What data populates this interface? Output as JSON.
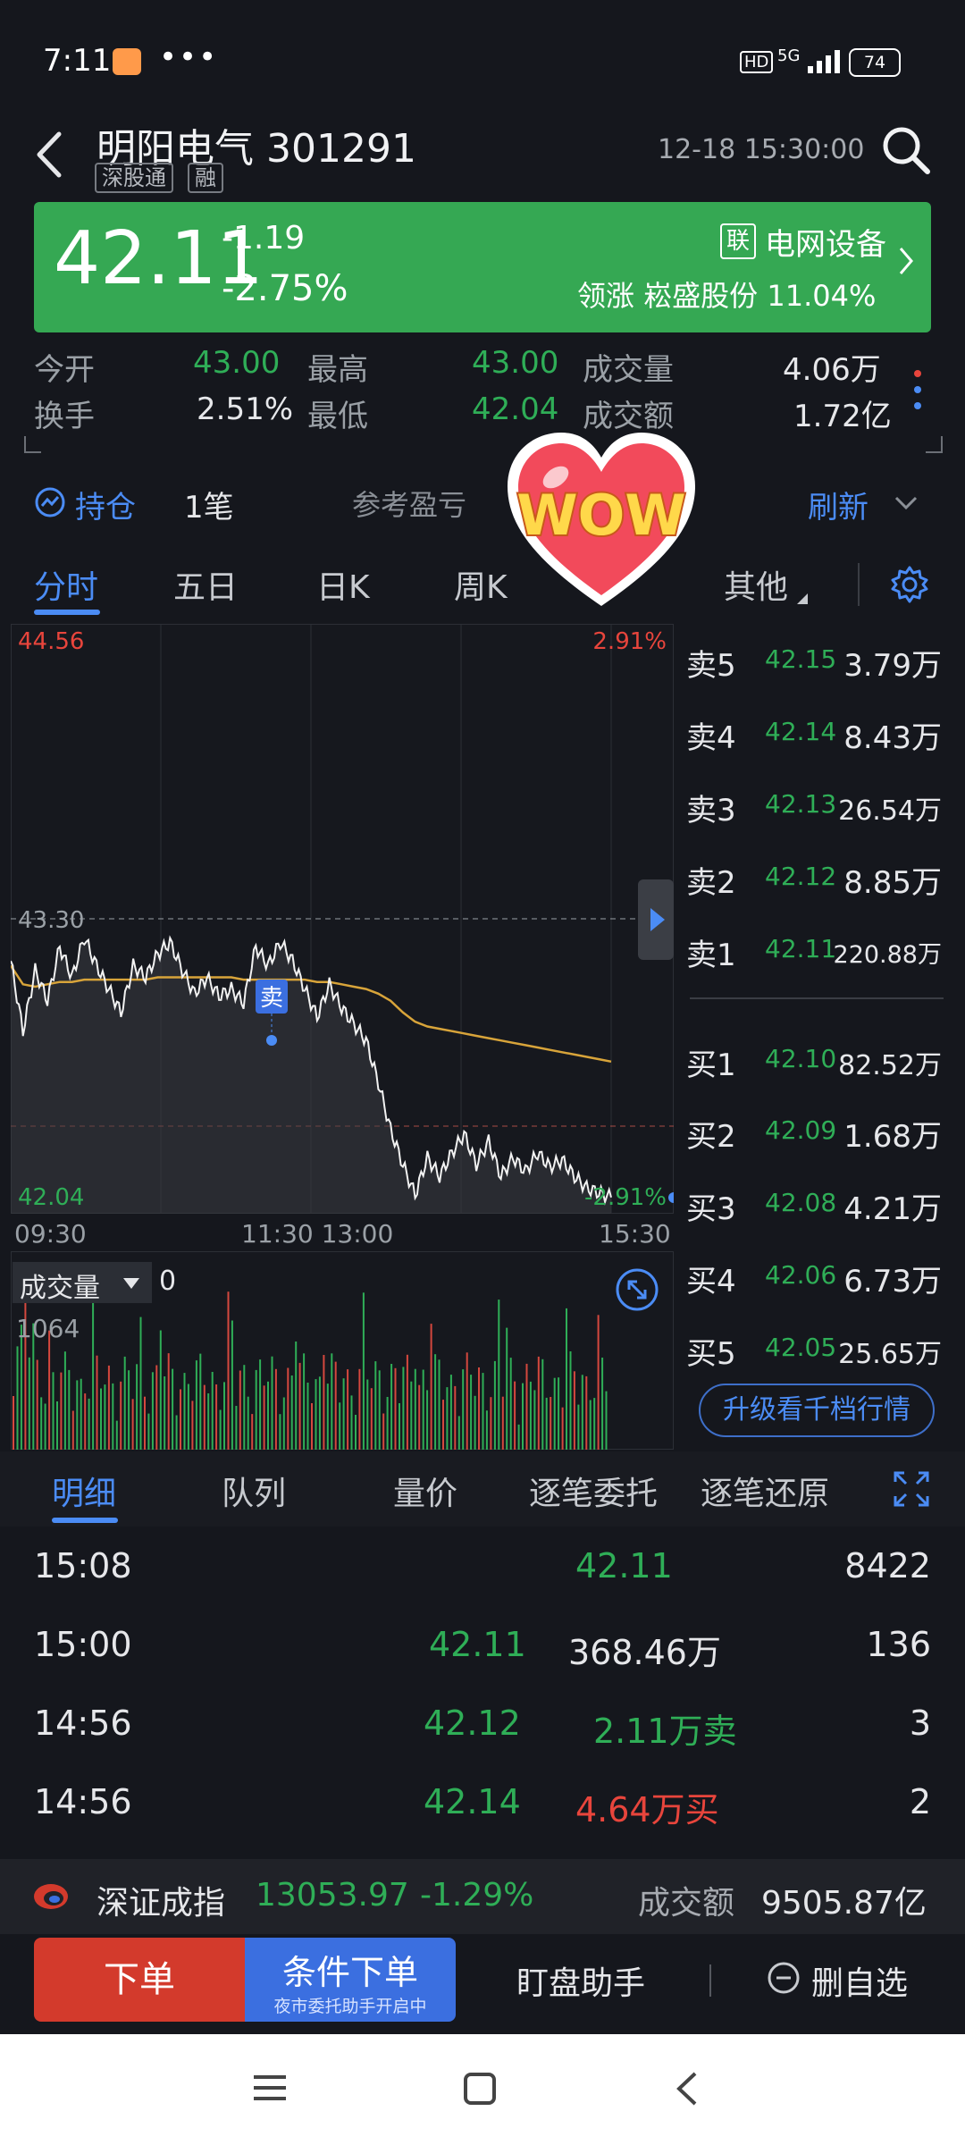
{
  "status": {
    "time": "7:11",
    "battery": "74",
    "hd": "HD",
    "network": "5G"
  },
  "header": {
    "name": "明阳电气 301291",
    "tags": [
      "深股通",
      "融"
    ],
    "datetime": "12-18 15:30:00"
  },
  "banner": {
    "price": "42.11",
    "change": "-1.19",
    "change_pct": "-2.75%",
    "sector_mark": "联",
    "sector": "电网设备",
    "leader": "领涨 崧盛股份 11.04%",
    "color": "#35a853"
  },
  "stats": {
    "open_label": "今开",
    "open": "43.00",
    "high_label": "最高",
    "high": "43.00",
    "volume_label": "成交量",
    "volume": "4.06万",
    "turnover_label": "换手",
    "turnover": "2.51%",
    "low_label": "最低",
    "low": "42.04",
    "amount_label": "成交额",
    "amount": "1.72亿"
  },
  "holdings": {
    "label": "持仓",
    "count": "1笔",
    "pnl_label": "参考盈亏",
    "refresh": "刷新"
  },
  "sticker": {
    "text": "WOW"
  },
  "chart_tabs": [
    "分时",
    "五日",
    "日K",
    "周K",
    "其他"
  ],
  "chart": {
    "y_top": "44.56",
    "y_mid": "43.30",
    "y_bottom": "42.04",
    "pct_top": "2.91%",
    "pct_bottom": "-2.91%",
    "times": [
      "09:30",
      "11:30 13:00",
      "15:30"
    ],
    "sell_marker": "卖"
  },
  "chart_data": {
    "type": "line",
    "title": "",
    "ylim": [
      42.04,
      44.56
    ],
    "prev_close": 43.3,
    "series": [
      {
        "name": "",
        "values": [
          43.12,
          42.82,
          43.08,
          42.95,
          43.18,
          43.05,
          43.22,
          43.1,
          43.0,
          42.9,
          43.1,
          43.05,
          43.15,
          43.2,
          43.08,
          42.98,
          43.05,
          42.97,
          43.0,
          42.94,
          43.18,
          43.1,
          43.2,
          43.12,
          43.0,
          42.88,
          43.02,
          42.92,
          42.85,
          42.78,
          42.6,
          42.4,
          42.25,
          42.12,
          42.28,
          42.2,
          42.3,
          42.38,
          42.25,
          42.35,
          42.2,
          42.28,
          42.22,
          42.3,
          42.24,
          42.27,
          42.2,
          42.15,
          42.13,
          42.11
        ]
      },
      {
        "name": "",
        "values": [
          43.1,
          43.02,
          43.01,
          43.02,
          43.03,
          43.03,
          43.04,
          43.04,
          43.04,
          43.04,
          43.04,
          43.04,
          43.05,
          43.05,
          43.05,
          43.05,
          43.05,
          43.05,
          43.05,
          43.04,
          43.04,
          43.04,
          43.04,
          43.04,
          43.04,
          43.03,
          43.03,
          43.02,
          43.01,
          43.0,
          42.98,
          42.95,
          42.9,
          42.86,
          42.84,
          42.83,
          42.82,
          42.81,
          42.8,
          42.79,
          42.78,
          42.77,
          42.76,
          42.75,
          42.74,
          42.73,
          42.72,
          42.71,
          42.7,
          42.69
        ]
      }
    ],
    "volume_max": "1064"
  },
  "volume": {
    "label": "成交量",
    "value": "0",
    "max": "1064"
  },
  "orderbook": {
    "sells": [
      {
        "label": "卖5",
        "price": "42.15",
        "vol": "3.79万"
      },
      {
        "label": "卖4",
        "price": "42.14",
        "vol": "8.43万"
      },
      {
        "label": "卖3",
        "price": "42.13",
        "vol": "26.54万"
      },
      {
        "label": "卖2",
        "price": "42.12",
        "vol": "8.85万"
      },
      {
        "label": "卖1",
        "price": "42.11",
        "vol": "220.88万"
      }
    ],
    "buys": [
      {
        "label": "买1",
        "price": "42.10",
        "vol": "82.52万"
      },
      {
        "label": "买2",
        "price": "42.09",
        "vol": "1.68万"
      },
      {
        "label": "买3",
        "price": "42.08",
        "vol": "4.21万"
      },
      {
        "label": "买4",
        "price": "42.06",
        "vol": "6.73万"
      },
      {
        "label": "买5",
        "price": "42.05",
        "vol": "25.65万"
      }
    ],
    "upgrade": "升级看千档行情"
  },
  "detail_tabs": [
    "明细",
    "队列",
    "量价",
    "逐笔委托",
    "逐笔还原"
  ],
  "trades": [
    {
      "time": "15:08",
      "price": "42.11",
      "amount": "",
      "count": "8422"
    },
    {
      "time": "15:00",
      "price": "42.11",
      "amount": "368.46万",
      "count": "136"
    },
    {
      "time": "14:56",
      "price": "42.12",
      "amount": "2.11万卖",
      "count": "3"
    },
    {
      "time": "14:56",
      "price": "42.14",
      "amount": "4.64万买",
      "count": "2"
    }
  ],
  "index_bar": {
    "name": "深证成指",
    "value": "13053.97",
    "pct": "-1.29%",
    "amount_label": "成交额",
    "amount": "9505.87亿"
  },
  "actions": {
    "order": "下单",
    "conditional": "条件下单",
    "conditional_sub": "夜市委托助手开启中",
    "watch": "盯盘助手",
    "remove": "删自选"
  }
}
